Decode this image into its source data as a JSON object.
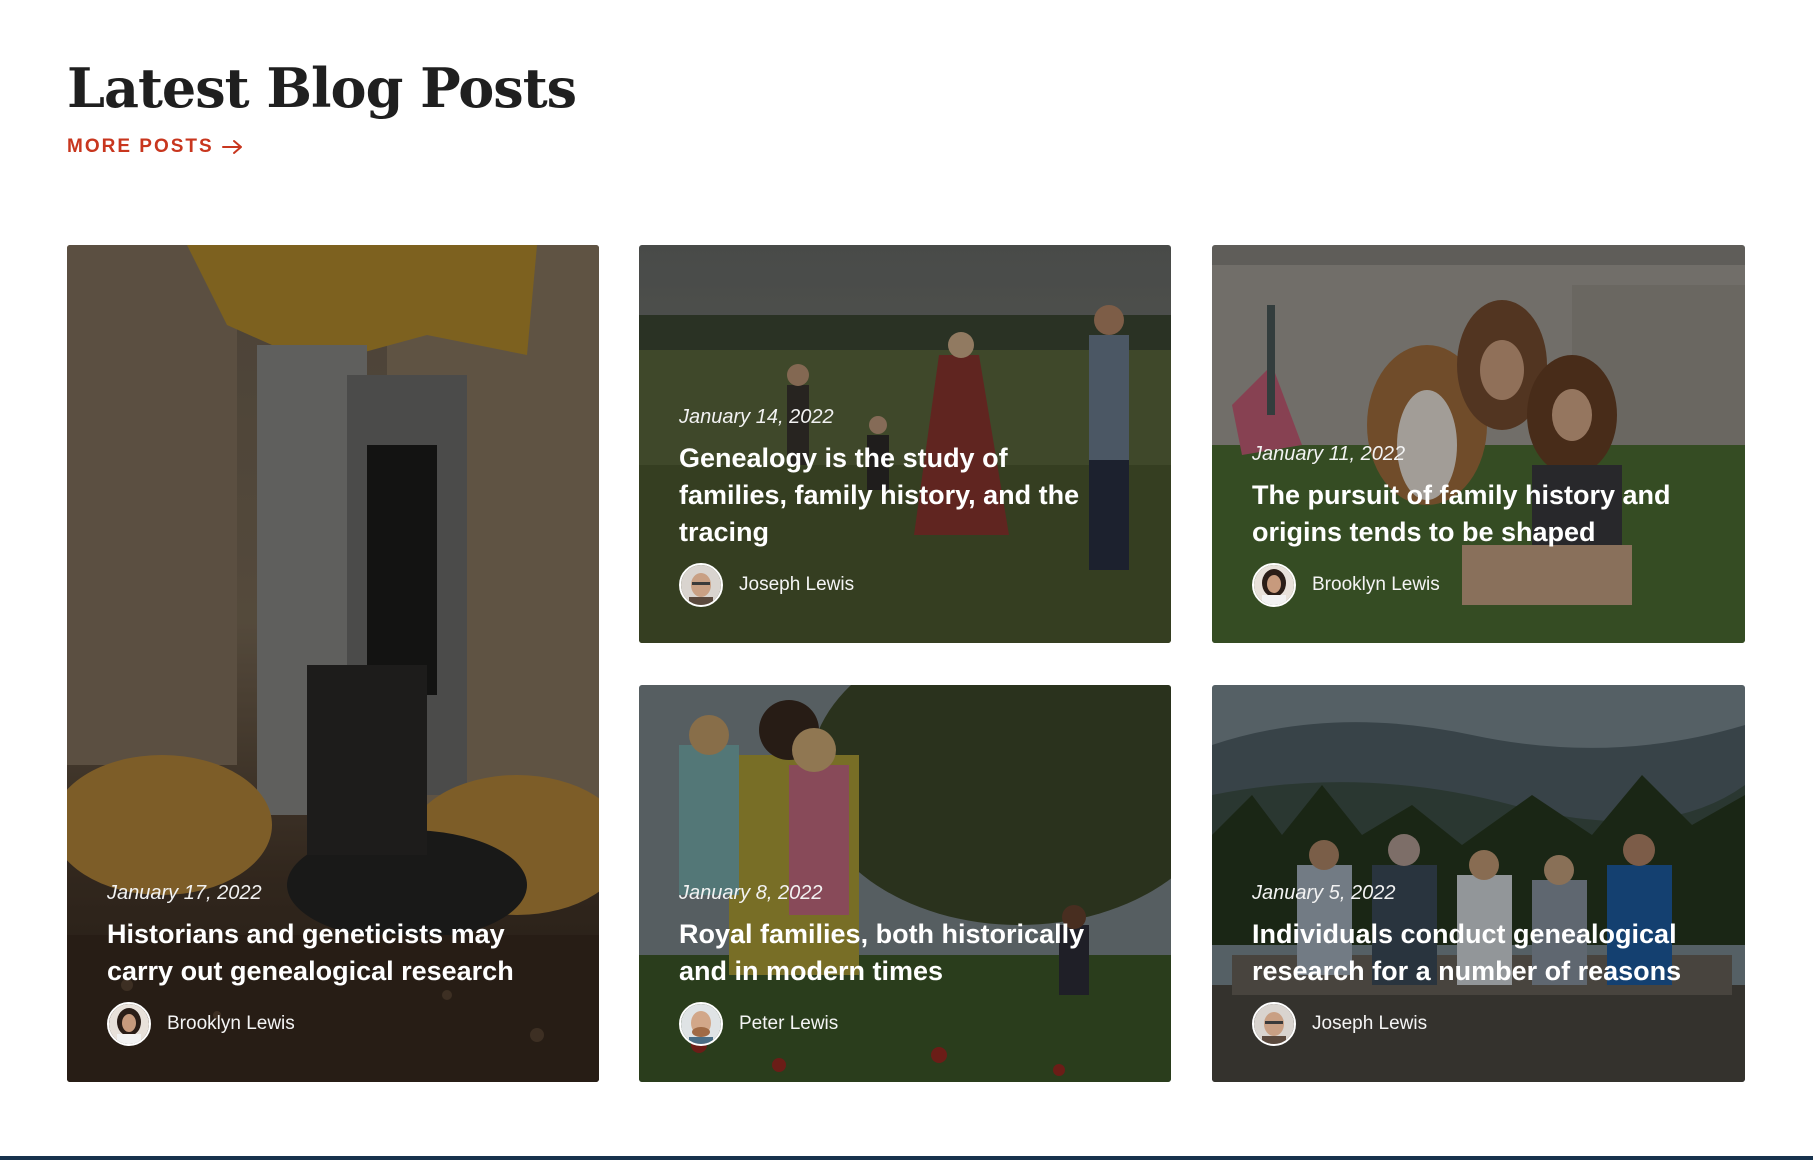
{
  "section": {
    "title": "Latest Blog Posts",
    "more_link": "MORE POSTS",
    "accent_color": "#c8361e"
  },
  "posts": [
    {
      "date": "January 17, 2022",
      "title": "Historians and geneticists may carry out genealogical research",
      "author": "Brooklyn Lewis",
      "image": "child-boots-on-dirt-photo"
    },
    {
      "date": "January 14, 2022",
      "title": "Genealogy is the study of families, family history, and the tracing",
      "author": "Joseph Lewis",
      "image": "family-walking-in-field-photo"
    },
    {
      "date": "January 11, 2022",
      "title": "The pursuit of family history and origins tends to be shaped",
      "author": "Brooklyn Lewis",
      "image": "mother-daughter-with-dog-photo"
    },
    {
      "date": "January 8, 2022",
      "title": "Royal families, both historically and in modern times",
      "author": "Peter Lewis",
      "image": "father-carrying-children-photo"
    },
    {
      "date": "January 5, 2022",
      "title": "Individuals conduct genealogical research for a number of reasons",
      "author": "Joseph Lewis",
      "image": "family-on-mountain-view-photo"
    }
  ]
}
